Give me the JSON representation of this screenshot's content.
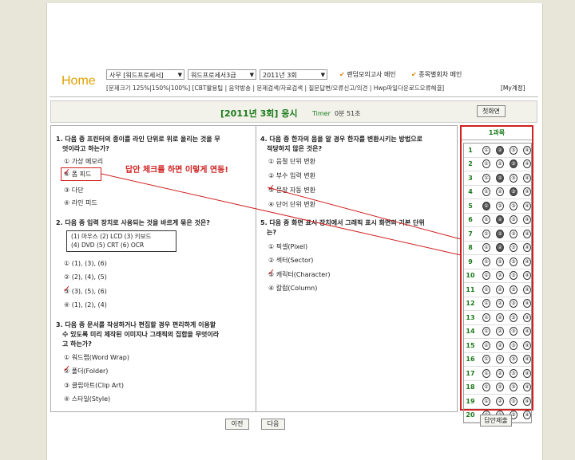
{
  "nav": {
    "home": "Home",
    "select1": "사무 [워드프로세서]",
    "select2": "워드프로세서3급",
    "select3": "2011년 3회",
    "check1": "랜덤모의고사 메인",
    "check2": "종목별회차 메인",
    "links": "[문제크기 125%|150%|100%] [CBT활용팁 | 음악방송 | 문제검색/자료검색 | 질문답변/오류신고/의견 | Hwp파일다운로드오류해결]",
    "account": "[My계정]"
  },
  "header": {
    "title": "[2011년 3회] 응시",
    "timer_label": "Timer",
    "timer_value": "0분 51초",
    "first_screen": "첫화면"
  },
  "questions": {
    "q1": {
      "text_l1": "1. 다음 중 프린터의 종이를 라인 단위로 위로 올리는 것을 무",
      "text_l2": "엇이라고 하는가?",
      "o1": "① 가상 메모리",
      "o2": "④ 폼 피드",
      "o3": "③ 다단",
      "o4": "④ 라인 피드"
    },
    "q2": {
      "text": "2. 다음 중 입력 장치로 사용되는 것을 바르게 묶은 것은?",
      "box_l1": "(1) 마우스 (2) LCD    (3) 키보드",
      "box_l2": "(4) DVD   (5) CRT    (6) OCR",
      "o1": "① (1), (3), (6)",
      "o2": "② (2), (4), (5)",
      "o3": "③ (3), (5), (6)",
      "o4": "④ (1), (2), (4)"
    },
    "q3": {
      "text_l1": "3. 다음 중 문서를 작성하거나 편집할 경우 편리하게 이용할",
      "text_l2": "수 있도록 미리 제작된 이미지나 그래픽의 집합을 무엇이라",
      "text_l3": "고 하는가?",
      "o1": "① 워드랩(Word Wrap)",
      "o2": "② 폴더(Folder)",
      "o3": "③ 클립아트(Clip Art)",
      "o4": "④ 스타일(Style)"
    },
    "q4": {
      "text_l1": "4. 다음 중 한자의 음을 알 경우 한자를 변환시키는 방법으로",
      "text_l2": "적당하지 않은 것은?",
      "o1": "① 음절 단위 변환",
      "o2": "② 부수 입력 변환",
      "o3": "③ 문장 자동 변환",
      "o4": "④ 단어 단위 변환"
    },
    "q5": {
      "text_l1": "5. 다음 중 화면 표시 장치에서 그래픽 표시 화면의 기본 단위",
      "text_l2": "는?",
      "o1": "① 픽셀(Pixel)",
      "o2": "② 섹터(Sector)",
      "o3": "③ 캐릭터(Character)",
      "o4": "④ 칼럼(Column)"
    }
  },
  "annotation": "답안 체크를 하면 이렇게 연동!",
  "answer_panel": {
    "header": "1과목",
    "rows": [
      {
        "n": "1",
        "sel": 2
      },
      {
        "n": "2",
        "sel": 3
      },
      {
        "n": "3",
        "sel": 2
      },
      {
        "n": "4",
        "sel": 3
      },
      {
        "n": "5",
        "sel": 1
      },
      {
        "n": "6",
        "sel": 2
      },
      {
        "n": "7",
        "sel": 2
      },
      {
        "n": "8",
        "sel": 2
      },
      {
        "n": "9",
        "sel": 0
      },
      {
        "n": "10",
        "sel": 0
      },
      {
        "n": "11",
        "sel": 0
      },
      {
        "n": "12",
        "sel": 0
      },
      {
        "n": "13",
        "sel": 0
      },
      {
        "n": "14",
        "sel": 0
      },
      {
        "n": "15",
        "sel": 0
      },
      {
        "n": "16",
        "sel": 0
      },
      {
        "n": "17",
        "sel": 0
      },
      {
        "n": "18",
        "sel": 0
      },
      {
        "n": "19",
        "sel": 0
      },
      {
        "n": "20",
        "sel": 0
      }
    ],
    "circle_labels": [
      "①",
      "②",
      "③",
      "④"
    ]
  },
  "footer": {
    "prev": "이전",
    "next": "다음",
    "submit": "답안제출"
  }
}
